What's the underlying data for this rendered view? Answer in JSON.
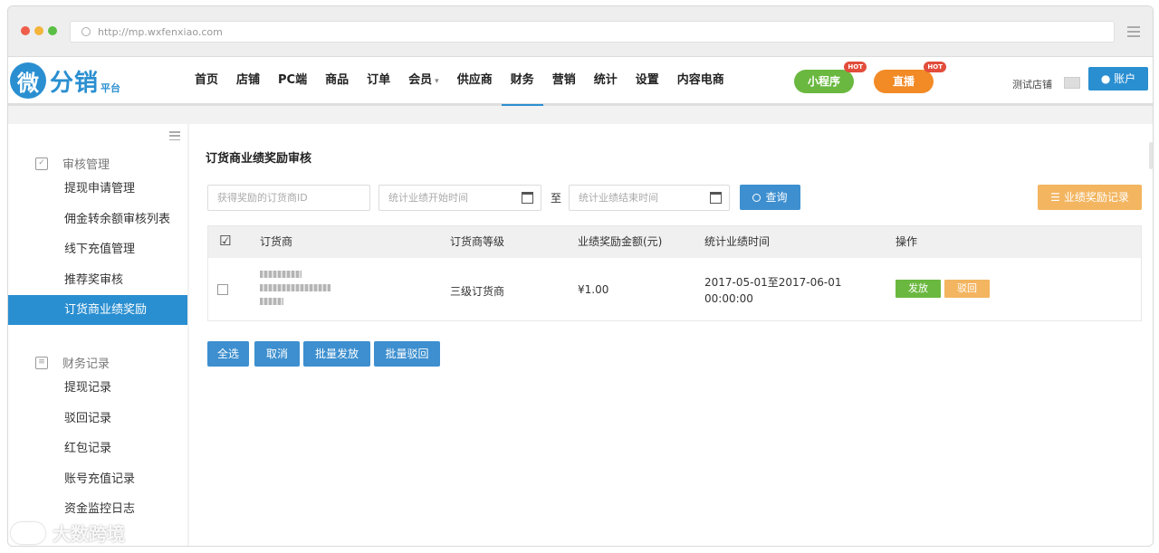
{
  "browser": {
    "url": "http://mp.wxfenxiao.com"
  },
  "brand": {
    "logo_char": "微",
    "name": "分销",
    "sub": "平台",
    "color": "#2a8fd1"
  },
  "nav": {
    "items": [
      {
        "label": "首页"
      },
      {
        "label": "店铺"
      },
      {
        "label": "PC端"
      },
      {
        "label": "商品"
      },
      {
        "label": "订单"
      },
      {
        "label": "会员",
        "arrow": "▾"
      },
      {
        "label": "供应商"
      },
      {
        "label": "财务",
        "active": true
      },
      {
        "label": "营销"
      },
      {
        "label": "统计"
      },
      {
        "label": "设置"
      },
      {
        "label": "内容电商"
      }
    ],
    "mini_program": {
      "label": "小程序",
      "badge": "HOT"
    },
    "live": {
      "label": "直播",
      "badge": "HOT"
    },
    "shop_name": "测试店铺",
    "account_label": "账户"
  },
  "sidebar": {
    "group1": {
      "label": "审核管理",
      "icon": "checklist-icon"
    },
    "group1_items": [
      {
        "label": "提现申请管理"
      },
      {
        "label": "佣金转余额审核列表"
      },
      {
        "label": "线下充值管理"
      },
      {
        "label": "推荐奖审核"
      },
      {
        "label": "订货商业绩奖励",
        "active": true
      }
    ],
    "group2": {
      "label": "财务记录",
      "icon": "ledger-icon"
    },
    "group2_items": [
      {
        "label": "提现记录"
      },
      {
        "label": "驳回记录"
      },
      {
        "label": "红包记录"
      },
      {
        "label": "账号充值记录"
      },
      {
        "label": "资金监控日志"
      }
    ]
  },
  "main": {
    "title": "订货商业绩奖励审核",
    "filters": {
      "distributor_id_placeholder": "获得奖励的订货商ID",
      "start_placeholder": "统计业绩开始时间",
      "to_label": "至",
      "end_placeholder": "统计业绩结束时间",
      "search_label": "查询",
      "records_label": "业绩奖励记录"
    },
    "table": {
      "headers": {
        "distributor": "订货商",
        "level": "订货商等级",
        "amount": "业绩奖励金额(元)",
        "period": "统计业绩时间",
        "actions": "操作"
      },
      "rows": [
        {
          "level": "三级订货商",
          "amount": "¥1.00",
          "period_line1": "2017-05-01至2017-06-01",
          "period_line2": "00:00:00",
          "issue_label": "发放",
          "reject_label": "驳回"
        }
      ]
    },
    "bulk": {
      "select_all": "全选",
      "cancel": "取消",
      "bulk_issue": "批量发放",
      "bulk_reject": "批量驳回"
    }
  },
  "watermark": {
    "text": "大数跨境"
  },
  "colors": {
    "primary": "#2a8fd1",
    "green": "#6ab83f",
    "orange": "#f28a26",
    "soft_orange": "#f3b560",
    "hot_red": "#e24d3c"
  }
}
